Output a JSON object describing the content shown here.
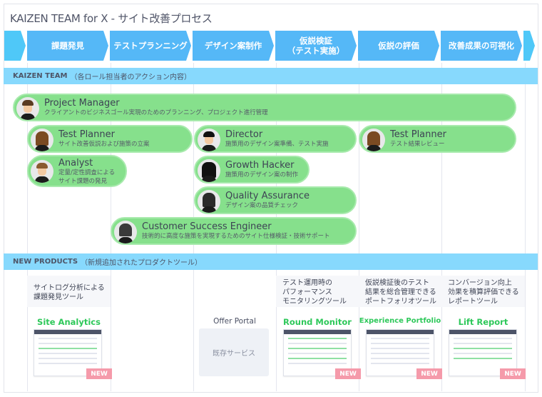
{
  "title": "KAIZEN TEAM for X - サイト改善プロセス",
  "process": [
    "課題発見",
    "テストプランニング",
    "デザイン案制作",
    "仮説検証\n（テスト実施）",
    "仮説の評価",
    "改善成果の可視化"
  ],
  "team_band": {
    "label": "KAIZEN TEAM",
    "sub": "（各ロール担当者のアクション内容）"
  },
  "roles": [
    {
      "name": "Project Manager",
      "desc": "クライアントのビジネスゴール実現のためのプランニング、プロジェクト進行管理"
    },
    {
      "name": "Test Planner",
      "desc": "サイト改善仮説および施策の立案"
    },
    {
      "name": "Director",
      "desc": "施策用のデザイン案準備、テスト実施"
    },
    {
      "name": "Test Planner",
      "desc": "テスト結果レビュー"
    },
    {
      "name": "Analyst",
      "desc": "定量/定性調査による\nサイト課題の発見"
    },
    {
      "name": "Growth Hacker",
      "desc": "施策用のデザイン案の制作"
    },
    {
      "name": "Quality Assurance",
      "desc": "デザイン案の品質チェック"
    },
    {
      "name": "Customer Success Engineer",
      "desc": "技術的に高度な施策を実現するためのサイト仕様検証・技術サポート"
    }
  ],
  "products_band": {
    "label": "NEW PRODUCTS",
    "sub": "（新規追加されたプロダクトツール）"
  },
  "products": [
    {
      "desc": "サイトログ分析による\n課題発見ツール",
      "name": "Site Analytics",
      "badge": "NEW"
    },
    {
      "name": "Offer Portal",
      "box": "既存サービス"
    },
    {
      "desc": "テスト運用時の\nパフォーマンス\nモニタリングツール",
      "name": "Round Monitor",
      "badge": "NEW"
    },
    {
      "desc": "仮説検証後のテスト\n結果を総合管理できる\nポートフォリオツール",
      "name": "Experience Portfolio",
      "badge": "NEW"
    },
    {
      "desc": "コンバージョン向上\n効果を積算評価できる\nレポートツール",
      "name": "Lift Report",
      "badge": "NEW"
    }
  ],
  "colors": {
    "arrow": "#55b8f7",
    "band": "#87d9fd",
    "pill": "#86e08c",
    "product_name": "#2ec85a",
    "new_badge": "#f59aaa"
  }
}
